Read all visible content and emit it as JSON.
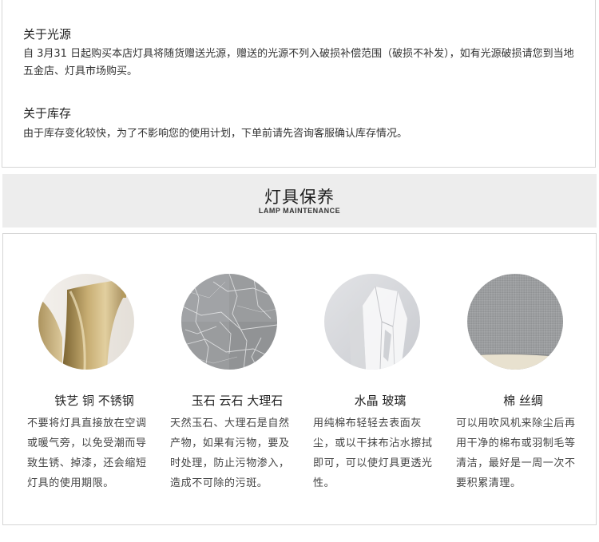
{
  "light_source": {
    "title": "关于光源",
    "body": "自 3月31 日起购买本店灯具将随货赠送光源，赠送的光源不列入破损补偿范围（破损不补发），如有光源破损请您到当地五金店、灯具市场购买。"
  },
  "stock": {
    "title": "关于库存",
    "body": "由于库存变化较快，为了不影响您的使用计划，下单前请先咨询客服确认库存情况。"
  },
  "banner": {
    "title": "灯具保养",
    "subtitle": "LAMP MAINTENANCE"
  },
  "care": [
    {
      "title": "铁艺 铜 不锈钢",
      "desc": "不要将灯具直接放在空调或暖气旁，以免受潮而导致生锈、掉漆，还会缩短灯具的使用期限。",
      "image": "brushed-brass-lamp"
    },
    {
      "title": "玉石 云石 大理石",
      "desc": "天然玉石、大理石是自然产物，如果有污物，要及时处理，防止污物渗入，造成不可除的污斑。",
      "image": "grey-marble"
    },
    {
      "title": "水晶 玻璃",
      "desc": "用纯棉布轻轻去表面灰尘，或以干抹布沾水擦拭即可，可以使灯具更透光性。",
      "image": "crystal-glass"
    },
    {
      "title": "棉 丝绸",
      "desc": "可以用吹风机来除尘后再用干净的棉布或羽制毛等清洁，最好是一周一次不要积累清理。",
      "image": "grey-fabric"
    }
  ]
}
